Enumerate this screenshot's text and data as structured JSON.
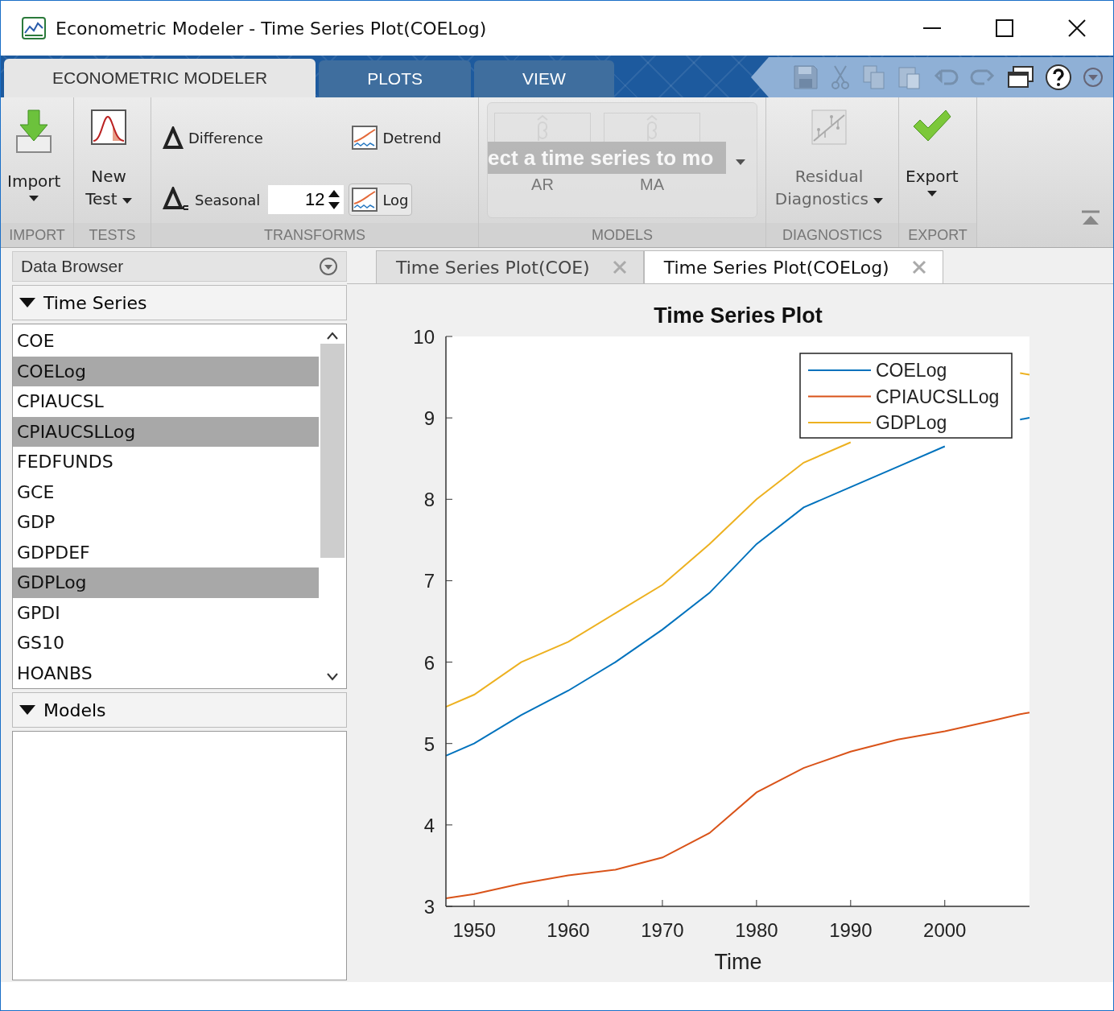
{
  "window": {
    "title": "Econometric Modeler - Time Series Plot(COELog)"
  },
  "ribbon_tabs": [
    {
      "label": "ECONOMETRIC MODELER",
      "selected": true
    },
    {
      "label": "PLOTS",
      "selected": false
    },
    {
      "label": "VIEW",
      "selected": false
    }
  ],
  "ribbon": {
    "import": {
      "label": "Import",
      "section": "IMPORT"
    },
    "tests": {
      "label": "New Test",
      "section": "TESTS"
    },
    "transforms": {
      "difference": "Difference",
      "seasonal": "Seasonal",
      "seasonal_value": "12",
      "detrend": "Detrend",
      "log": "Log",
      "log_hovered": true,
      "section": "TRANSFORMS"
    },
    "models": {
      "banner": "ect a time series to mo",
      "items": [
        "AR",
        "MA"
      ],
      "disabled": true,
      "section": "MODELS"
    },
    "diagnostics": {
      "label": "Residual Diagnostics",
      "disabled": true,
      "section": "DIAGNOSTICS"
    },
    "export": {
      "label": "Export",
      "disabled": false,
      "section": "EXPORT"
    }
  },
  "data_browser": {
    "title": "Data Browser",
    "sections": [
      {
        "title": "Time Series",
        "expanded": true,
        "items": [
          {
            "label": "COE",
            "selected": false
          },
          {
            "label": "COELog",
            "selected": true
          },
          {
            "label": "CPIAUCSL",
            "selected": false
          },
          {
            "label": "CPIAUCSLLog",
            "selected": true
          },
          {
            "label": "FEDFUNDS",
            "selected": false
          },
          {
            "label": "GCE",
            "selected": false
          },
          {
            "label": "GDP",
            "selected": false
          },
          {
            "label": "GDPDEF",
            "selected": false
          },
          {
            "label": "GDPLog",
            "selected": true
          },
          {
            "label": "GPDI",
            "selected": false
          },
          {
            "label": "GS10",
            "selected": false
          },
          {
            "label": "HOANBS",
            "selected": false
          }
        ]
      },
      {
        "title": "Models",
        "expanded": true
      }
    ]
  },
  "doc_tabs": [
    {
      "label": "Time Series Plot(COE)",
      "selected": false
    },
    {
      "label": "Time Series Plot(COELog)",
      "selected": true
    }
  ],
  "plot": {
    "chart_data": {
      "type": "line",
      "title": "Time Series Plot",
      "xlabel": "Time",
      "x": [
        1947,
        1950,
        1955,
        1960,
        1965,
        1970,
        1975,
        1980,
        1985,
        1990,
        1995,
        2000,
        2005,
        2008,
        2009
      ],
      "series": [
        {
          "name": "COELog",
          "color": "#0072bd",
          "values": [
            4.85,
            5.0,
            5.35,
            5.65,
            6.0,
            6.4,
            6.85,
            7.45,
            7.9,
            8.15,
            8.4,
            8.65,
            null,
            8.98,
            9.0
          ]
        },
        {
          "name": "CPIAUCSLLog",
          "color": "#d95319",
          "values": [
            3.1,
            3.15,
            3.28,
            3.38,
            3.45,
            3.6,
            3.9,
            4.4,
            4.7,
            4.9,
            5.05,
            5.15,
            5.28,
            5.36,
            5.38
          ]
        },
        {
          "name": "GDPLog",
          "color": "#edb120",
          "values": [
            5.45,
            5.6,
            6.0,
            6.25,
            6.6,
            6.95,
            7.45,
            8.0,
            8.45,
            8.7,
            null,
            null,
            null,
            9.55,
            9.53
          ]
        }
      ],
      "legend": "upper right",
      "xlim": [
        1947,
        2009
      ],
      "ylim": [
        3,
        10
      ],
      "xticks": [
        1950,
        1960,
        1970,
        1980,
        1990,
        2000
      ],
      "yticks": [
        3,
        4,
        5,
        6,
        7,
        8,
        9,
        10
      ]
    }
  }
}
